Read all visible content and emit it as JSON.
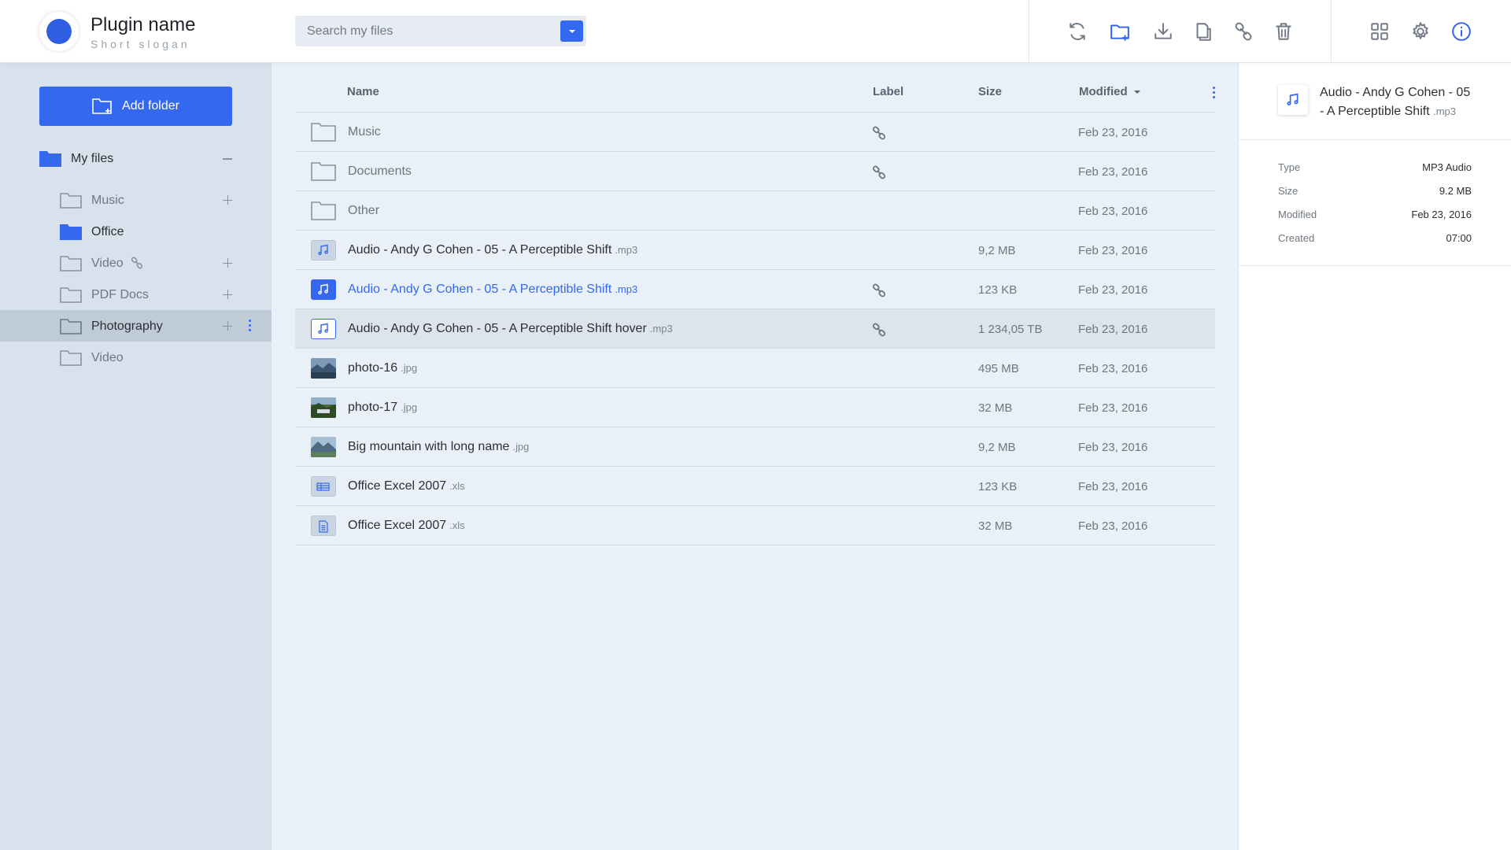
{
  "app": {
    "name": "Plugin name",
    "slogan": "Short slogan"
  },
  "search": {
    "placeholder": "Search my files"
  },
  "toolbar": {
    "actions": [
      "refresh-icon",
      "new-folder-icon",
      "download-icon",
      "copy-icon",
      "link-icon",
      "trash-icon"
    ],
    "views": [
      "grid-icon",
      "gear-icon",
      "info-icon"
    ],
    "accent": "#3568f0"
  },
  "sidebar": {
    "add_folder_label": "Add folder",
    "root": {
      "label": "My files"
    },
    "items": [
      {
        "label": "Music"
      },
      {
        "label": "Office"
      },
      {
        "label": "Video"
      },
      {
        "label": "PDF Docs"
      },
      {
        "label": "Photography"
      },
      {
        "label": "Video"
      }
    ]
  },
  "list": {
    "columns": {
      "name": "Name",
      "label": "Label",
      "size": "Size",
      "modified": "Modified"
    },
    "rows": [
      {
        "name": "Music",
        "ext": "",
        "size": "",
        "modified": "Feb 23, 2016"
      },
      {
        "name": "Documents",
        "ext": "",
        "size": "",
        "modified": "Feb 23, 2016"
      },
      {
        "name": "Other",
        "ext": "",
        "size": "",
        "modified": "Feb 23, 2016"
      },
      {
        "name": "Audio - Andy G Cohen - 05 - A Perceptible Shift",
        "ext": ".mp3",
        "size": "9,2 MB",
        "modified": "Feb 23, 2016"
      },
      {
        "name": "Audio - Andy G Cohen - 05 - A Perceptible Shift",
        "ext": ".mp3",
        "size": "123 KB",
        "modified": "Feb 23, 2016"
      },
      {
        "name": "Audio - Andy G Cohen - 05 - A Perceptible Shift hover",
        "ext": ".mp3",
        "size": "1 234,05 TB",
        "modified": "Feb 23, 2016"
      },
      {
        "name": "photo-16",
        "ext": ".jpg",
        "size": "495 MB",
        "modified": "Feb 23, 2016"
      },
      {
        "name": "photo-17",
        "ext": ".jpg",
        "size": "32 MB",
        "modified": "Feb 23, 2016"
      },
      {
        "name": "Big mountain with long name",
        "ext": ".jpg",
        "size": "9,2 MB",
        "modified": "Feb 23, 2016"
      },
      {
        "name": "Office Excel 2007",
        "ext": ".xls",
        "size": "123 KB",
        "modified": "Feb 23, 2016"
      },
      {
        "name": "Office Excel 2007",
        "ext": ".xls",
        "size": "32 MB",
        "modified": "Feb 23, 2016"
      }
    ]
  },
  "details": {
    "title": "Audio - Andy G Cohen - 05 - A Perceptible Shift",
    "ext": ".mp3",
    "props": [
      {
        "key": "Type",
        "value": "MP3 Audio"
      },
      {
        "key": "Size",
        "value": "9.2 MB"
      },
      {
        "key": "Modified",
        "value": "Feb 23, 2016"
      },
      {
        "key": "Created",
        "value": "07:00"
      }
    ]
  }
}
